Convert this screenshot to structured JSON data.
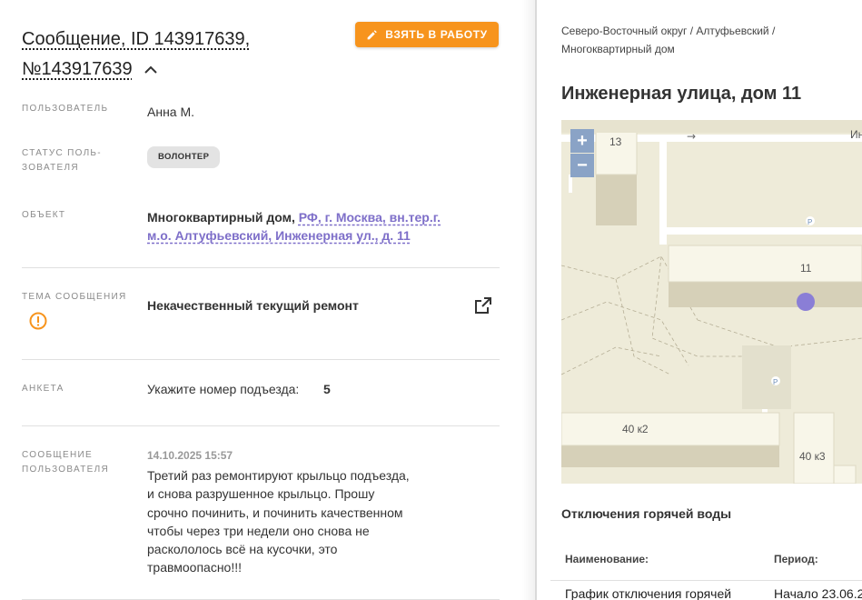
{
  "message": {
    "title": "Сообщение, ID 143917639, №143917639",
    "take_button_label": "ВЗЯТЬ В РАБОТУ",
    "fields": {
      "user_label": "ПОЛЬЗОВАТЕЛЬ",
      "user_value": "Анна М.",
      "user_status_label": "СТАТУС ПОЛЬ-ЗОВАТЕЛЯ",
      "user_status_badge": "ВОЛОНТЕР",
      "object_label": "ОБЪЕКТ",
      "object_type": "Многоквартирный дом,",
      "object_address_link": "РФ, г. Москва, вн.тер.г. м.о. Алтуфьевский, Инженерная ул., д. 11",
      "topic_label": "ТЕМА СООБЩЕНИЯ",
      "topic_value": "Некачественный текущий ремонт",
      "form_label": "АНКЕТА",
      "form_question": "Укажите номер подъезда:",
      "form_answer": "5",
      "user_message_label": "СООБЩЕНИЕ ПОЛЬЗОВАТЕЛЯ",
      "user_message_date": "14.10.2025 15:57",
      "user_message_text": "Третий раз ремонтируют крыльцо подъезда, и снова разрушенное крыльцо. Прошу срочно починить, и починить качественном чтобы через три недели оно снова не раскололось всё на кусочки, это травмоопасно!!!"
    }
  },
  "object_panel": {
    "breadcrumbs": "Северо-Восточный округ / Алтуфьевский / Многоквартирный дом",
    "address_title": "Инженерная улица, дом 11",
    "map": {
      "zoom_in": "+",
      "zoom_out": "−",
      "labels": {
        "b13": "13",
        "b11": "11",
        "b40k2": "40 к2",
        "b40k3": "40 к3",
        "street": "Ин",
        "parking": "P",
        "arrow": "→"
      }
    },
    "outages_title": "Отключения горячей воды",
    "table": {
      "headers": [
        "Наименование:",
        "Период:"
      ],
      "rows": [
        [
          "График отключения горячей",
          "Начало 23.06.2"
        ]
      ]
    }
  },
  "colors": {
    "accent_orange": "#f7941d",
    "link_purple": "#7e6fc9",
    "map_marker": "#8a7ed6"
  }
}
